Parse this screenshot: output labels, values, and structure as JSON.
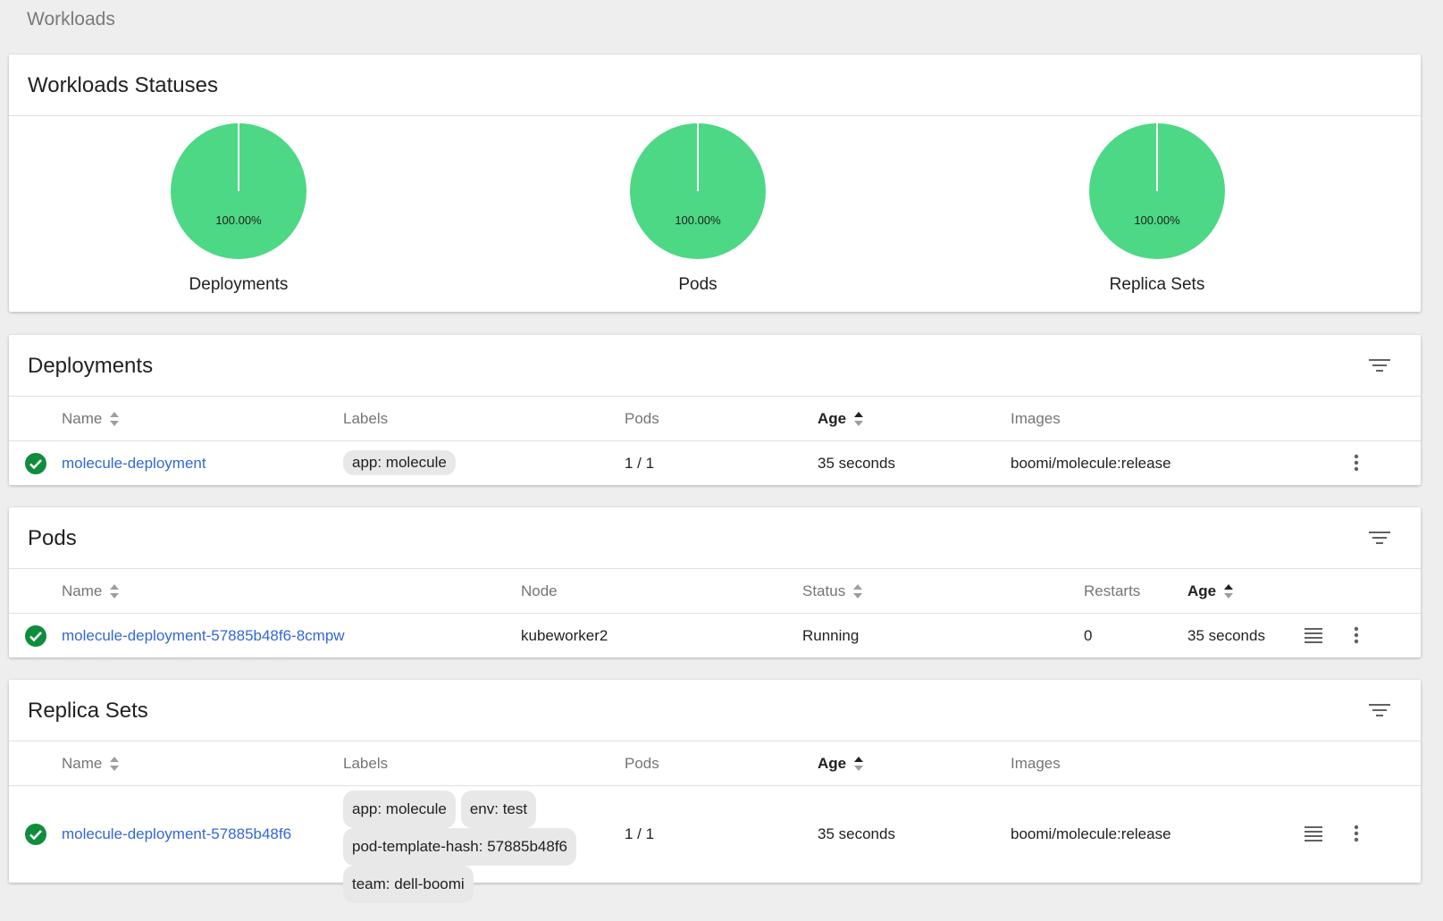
{
  "page": {
    "title": "Workloads"
  },
  "statuses": {
    "title": "Workloads Statuses",
    "charts": [
      {
        "label": "Deployments",
        "percent_text": "100.00%",
        "value": 100,
        "color": "#4cd884"
      },
      {
        "label": "Pods",
        "percent_text": "100.00%",
        "value": 100,
        "color": "#4cd884"
      },
      {
        "label": "Replica Sets",
        "percent_text": "100.00%",
        "value": 100,
        "color": "#4cd884"
      }
    ]
  },
  "deployments": {
    "title": "Deployments",
    "headers": {
      "name": "Name",
      "labels": "Labels",
      "pods": "Pods",
      "age": "Age",
      "images": "Images"
    },
    "rows": [
      {
        "name": "molecule-deployment",
        "labels": [
          "app: molecule"
        ],
        "pods": "1 / 1",
        "age": "35 seconds",
        "images": "boomi/molecule:release"
      }
    ]
  },
  "pods": {
    "title": "Pods",
    "headers": {
      "name": "Name",
      "node": "Node",
      "status": "Status",
      "restarts": "Restarts",
      "age": "Age"
    },
    "rows": [
      {
        "name": "molecule-deployment-57885b48f6-8cmpw",
        "node": "kubeworker2",
        "status": "Running",
        "restarts": "0",
        "age": "35 seconds"
      }
    ]
  },
  "replica_sets": {
    "title": "Replica Sets",
    "headers": {
      "name": "Name",
      "labels": "Labels",
      "pods": "Pods",
      "age": "Age",
      "images": "Images"
    },
    "rows": [
      {
        "name": "molecule-deployment-57885b48f6",
        "labels": [
          "app: molecule",
          "env: test",
          "pod-template-hash: 57885b48f6",
          "team: dell-boomi"
        ],
        "pods": "1 / 1",
        "age": "35 seconds",
        "images": "boomi/molecule:release"
      }
    ]
  },
  "colors": {
    "success": "#0f8c3c",
    "link": "#3367d6",
    "pie": "#4cd884"
  },
  "icons": {
    "status": "check-circle-icon",
    "filter": "filter-icon",
    "more": "more-vert-icon",
    "logs": "logs-icon"
  }
}
